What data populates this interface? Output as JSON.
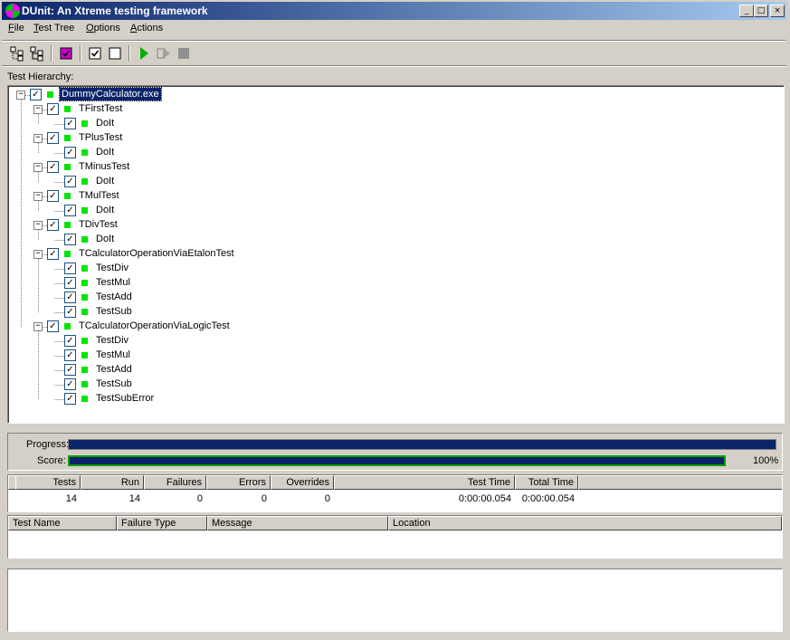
{
  "window": {
    "title": "DUnit: An Xtreme testing framework",
    "controls": {
      "minimize": "_",
      "maximize": "□",
      "close": "×"
    }
  },
  "menu": [
    {
      "label": "File",
      "underline": "F"
    },
    {
      "label": "Test Tree",
      "underline": "T"
    },
    {
      "label": "Options",
      "underline": "O"
    },
    {
      "label": "Actions",
      "underline": "A"
    }
  ],
  "toolbar": {
    "icons": [
      "select-all-icon",
      "deselect-all-icon",
      "select-failed-icon",
      "check-all-icon",
      "uncheck-all-icon",
      "run-icon",
      "run-selected-icon",
      "stop-icon"
    ]
  },
  "hierarchy_label": "Test Hierarchy:",
  "tree": [
    {
      "label": "DummyCalculator.exe",
      "level": 0,
      "expander": "−",
      "checked": true,
      "status": "pass",
      "selected": true
    },
    {
      "label": "TFirstTest",
      "level": 1,
      "expander": "−",
      "checked": true,
      "status": "pass"
    },
    {
      "label": "DoIt",
      "level": 2,
      "checked": true,
      "status": "pass"
    },
    {
      "label": "TPlusTest",
      "level": 1,
      "expander": "−",
      "checked": true,
      "status": "pass"
    },
    {
      "label": "DoIt",
      "level": 2,
      "checked": true,
      "status": "pass"
    },
    {
      "label": "TMinusTest",
      "level": 1,
      "expander": "−",
      "checked": true,
      "status": "pass"
    },
    {
      "label": "DoIt",
      "level": 2,
      "checked": true,
      "status": "pass"
    },
    {
      "label": "TMulTest",
      "level": 1,
      "expander": "−",
      "checked": true,
      "status": "pass"
    },
    {
      "label": "DoIt",
      "level": 2,
      "checked": true,
      "status": "pass"
    },
    {
      "label": "TDivTest",
      "level": 1,
      "expander": "−",
      "checked": true,
      "status": "pass"
    },
    {
      "label": "DoIt",
      "level": 2,
      "checked": true,
      "status": "pass"
    },
    {
      "label": "TCalculatorOperationViaEtalonTest",
      "level": 1,
      "expander": "−",
      "checked": true,
      "status": "pass"
    },
    {
      "label": "TestDiv",
      "level": 2,
      "checked": true,
      "status": "pass"
    },
    {
      "label": "TestMul",
      "level": 2,
      "checked": true,
      "status": "pass"
    },
    {
      "label": "TestAdd",
      "level": 2,
      "checked": true,
      "status": "pass"
    },
    {
      "label": "TestSub",
      "level": 2,
      "checked": true,
      "status": "pass"
    },
    {
      "label": "TCalculatorOperationViaLogicTest",
      "level": 1,
      "expander": "−",
      "checked": true,
      "status": "pass"
    },
    {
      "label": "TestDiv",
      "level": 2,
      "checked": true,
      "status": "pass"
    },
    {
      "label": "TestMul",
      "level": 2,
      "checked": true,
      "status": "pass"
    },
    {
      "label": "TestAdd",
      "level": 2,
      "checked": true,
      "status": "pass"
    },
    {
      "label": "TestSub",
      "level": 2,
      "checked": true,
      "status": "pass"
    },
    {
      "label": "TestSubError",
      "level": 2,
      "checked": true,
      "status": "pass"
    }
  ],
  "progress": {
    "label": "Progress:",
    "fraction": 1.0
  },
  "score": {
    "label": "Score:",
    "fraction": 1.0,
    "text": "100%"
  },
  "stats": {
    "headers": [
      "Tests",
      "Run",
      "Failures",
      "Errors",
      "Overrides",
      "Test Time",
      "Total Time"
    ],
    "values": [
      "14",
      "14",
      "0",
      "0",
      "0",
      "0:00:00.054",
      "0:00:00.054"
    ]
  },
  "failures": {
    "headers": [
      "Test Name",
      "Failure Type",
      "Message",
      "Location"
    ]
  },
  "colors": {
    "pass": "#00e600",
    "progress_fill": "#0a246a",
    "score_fill": "#0a246a",
    "score_border": "#00a000",
    "title_start": "#0a246a",
    "title_end": "#a6caf0"
  }
}
